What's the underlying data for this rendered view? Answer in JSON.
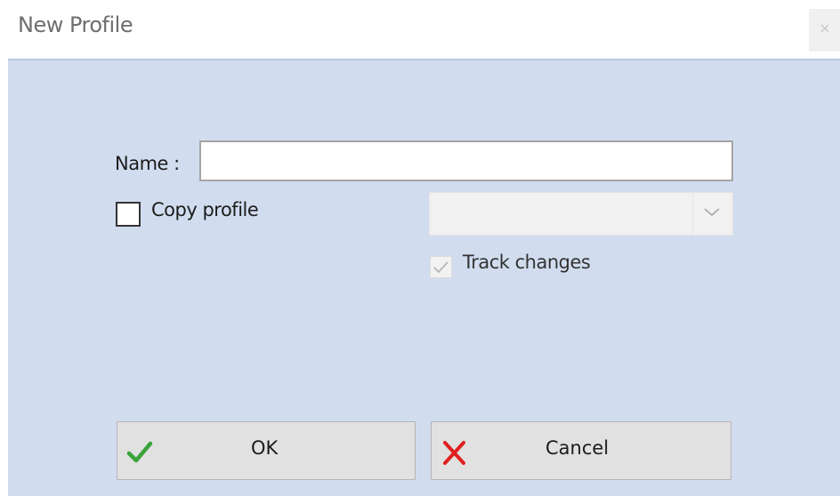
{
  "window": {
    "title": "New Profile",
    "close_glyph": "×"
  },
  "form": {
    "name_label": "Name :",
    "name_value": "",
    "copy_profile_label": "Copy profile",
    "copy_profile_checked": false,
    "profile_select_value": "",
    "profile_select_enabled": false,
    "track_changes_label": "Track changes",
    "track_changes_checked": true,
    "track_changes_enabled": false
  },
  "buttons": {
    "ok_label": "OK",
    "ok_icon": "checkmark-icon",
    "cancel_label": "Cancel",
    "cancel_icon": "red-x-icon"
  },
  "colors": {
    "client_background": "#d1ddef",
    "ok_icon": "#3aa33a",
    "cancel_icon": "#e02020"
  }
}
